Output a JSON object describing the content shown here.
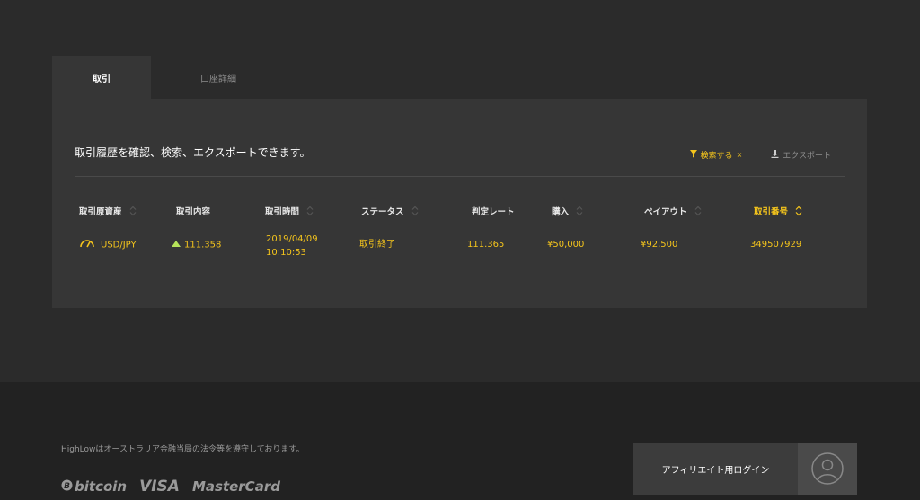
{
  "tabs": [
    {
      "label": "取引",
      "active": true
    },
    {
      "label": "口座詳細",
      "active": false
    }
  ],
  "panel": {
    "description": "取引履歴を確認、検索、エクスポートできます。",
    "filter_label": "検索する",
    "filter_clear": "×",
    "export_label": "エクスポート"
  },
  "table": {
    "headers": [
      "取引原資産",
      "取引内容",
      "取引時間",
      "ステータス",
      "判定レート",
      "購入",
      "ペイアウト",
      "取引番号"
    ],
    "active_sort_column": "取引番号",
    "rows": [
      {
        "asset": "USD/JPY",
        "direction": "up",
        "content_rate": "111.358",
        "date": "2019/04/09",
        "time": "10:10:53",
        "status": "取引終了",
        "judge_rate": "111.365",
        "purchase": "¥50,000",
        "payout": "¥92,500",
        "trade_id": "349507929"
      }
    ]
  },
  "footer": {
    "disclaimer": "HighLowはオーストラリア金融当局の法令等を遵守しております。",
    "payments": [
      "bitcoin",
      "VISA",
      "MasterCard"
    ],
    "affiliate_login": "アフィリエイト用ログイン"
  },
  "colors": {
    "accent": "#f5c51c",
    "up_arrow": "#b6e35a",
    "background": "#2b2b2b",
    "panel": "#363636",
    "footer": "#222222"
  },
  "icons": {
    "filter": "funnel-icon",
    "export": "download-icon",
    "asset": "gauge-icon",
    "direction": "up-arrow-icon",
    "sort": "sort-chevrons-icon",
    "avatar": "user-avatar-icon"
  }
}
